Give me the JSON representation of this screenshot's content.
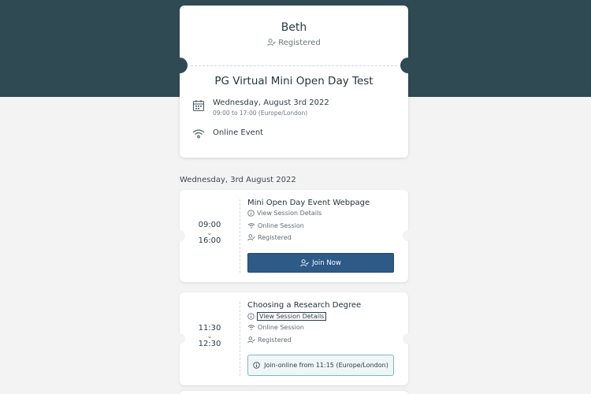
{
  "attendee": {
    "name": "Beth",
    "status": "Registered"
  },
  "event": {
    "title": "PG Virtual Mini Open Day Test",
    "date": "Wednesday, August 3rd 2022",
    "time_range": "09:00 to 17:00 (Europe/London)",
    "location": "Online Event"
  },
  "schedule": {
    "date_heading": "Wednesday, 3rd August 2022",
    "sessions": [
      {
        "start": "09:00",
        "end": "16:00",
        "title": "Mini Open Day Event Webpage",
        "details_link": "View Session Details",
        "type": "Online Session",
        "status": "Registered",
        "action_label": "Join Now"
      },
      {
        "start": "11:30",
        "end": "12:30",
        "title": "Choosing a Research Degree",
        "details_link": "View Session Details",
        "type": "Online Session",
        "status": "Registered",
        "notice": "Join-online from 11:15 (Europe/London)"
      }
    ]
  },
  "colors": {
    "header_band": "#2f4a52",
    "page_bg": "#f3f3f3",
    "primary_button": "#2e5a88",
    "info_border": "#7fb6c2"
  },
  "icons": {
    "calendar": "calendar-icon",
    "wifi": "wifi-icon",
    "user_check": "user-check-icon",
    "info": "info-icon",
    "chevron": "chevron-down-icon"
  }
}
